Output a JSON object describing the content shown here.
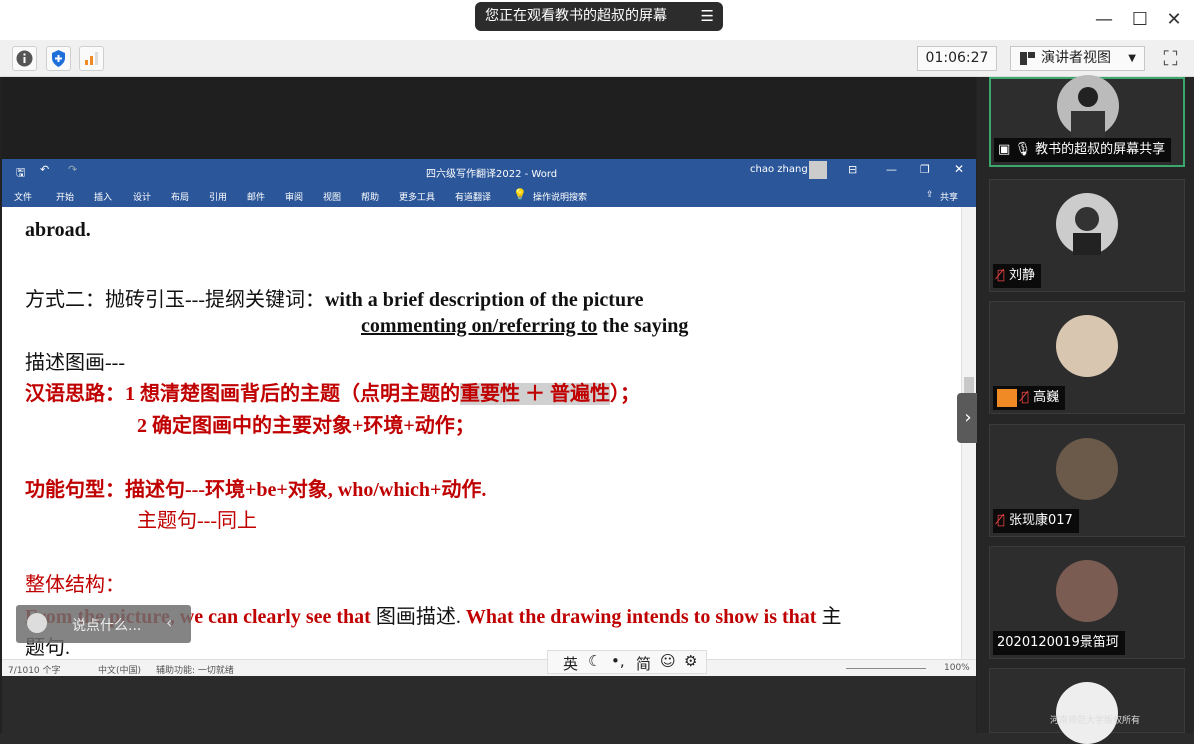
{
  "titlebar": {
    "viewing_text": "您正在观看教书的超叔的屏幕",
    "menu_icon": "list-icon"
  },
  "toolbar": {
    "timer": "01:06:27",
    "view_mode": "演讲者视图"
  },
  "word": {
    "doc_title": "四六级写作翻译2022  -  Word",
    "user": "chao zhang",
    "ribbon": [
      "文件",
      "开始",
      "插入",
      "设计",
      "布局",
      "引用",
      "邮件",
      "审阅",
      "视图",
      "帮助",
      "更多工具",
      "有道翻译"
    ],
    "tell_me": "操作说明搜索",
    "share": "共享",
    "status_words": "7/1010 个字",
    "status_lang": "中文(中国)",
    "status_access": "辅助功能: 一切就绪",
    "zoom": "100%"
  },
  "doc": {
    "l1": "abroad.",
    "l2a": "方式二：抛砖引玉---提纲关键词：",
    "l2b": "with a brief description of the picture",
    "l3a": "commenting on/referring to",
    "l3b": " the saying",
    "l4": "描述图画---",
    "l5a": "汉语思路：1 想清楚图画背后的主题（点明主题的",
    "l5b": "重要性 ＋ 普遍性",
    "l5c": "）；",
    "l6": "2 确定图画中的主要对象+环境+动作；",
    "l7a": "功能句型：",
    "l7b": "描述句---环境+be+对象, who/which+动作.",
    "l8": "主题句---同上",
    "l9": "整体结构：",
    "l10a": "From the picture, we can clearly see that",
    "l10b": "图画描述.",
    "l10c": "What the drawing intends to show is that",
    "l10d": "主",
    "l11": "题句."
  },
  "chat": {
    "placeholder": "说点什么..."
  },
  "ime": {
    "lang": "英",
    "mode": "简"
  },
  "participants": [
    {
      "name": "教书的超叔的屏幕共享"
    },
    {
      "name": "刘静"
    },
    {
      "name": "高巍"
    },
    {
      "name": "张现康017"
    },
    {
      "name": "2020120019景笛珂"
    }
  ],
  "watermark": "河南师范大学版权所有"
}
